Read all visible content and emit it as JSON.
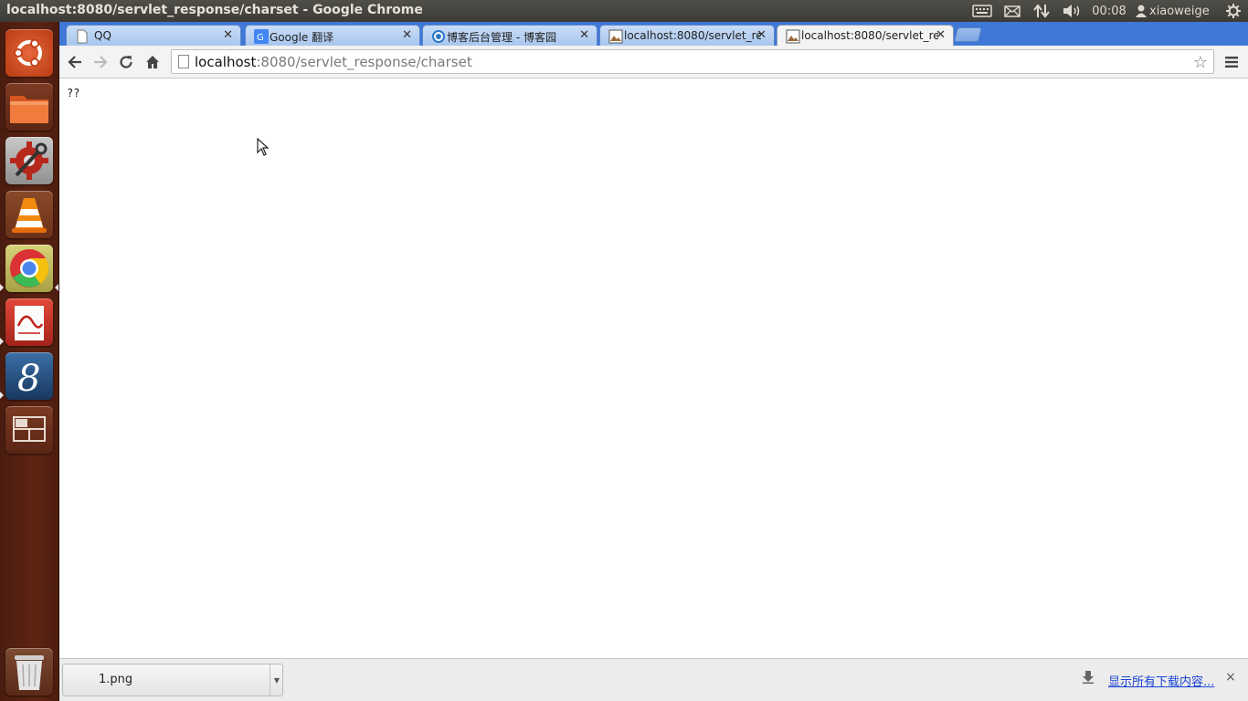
{
  "window": {
    "title": "localhost:8080/servlet_response/charset - Google Chrome"
  },
  "panel": {
    "clock": "00:08",
    "user": "xiaoweige",
    "icons": [
      "keyboard-icon",
      "mail-icon",
      "network-icon",
      "volume-icon",
      "user-icon",
      "session-gear-icon"
    ]
  },
  "launcher": {
    "items": [
      "dash-home",
      "files",
      "system-settings",
      "vlc",
      "chrome",
      "document-viewer",
      "scribes-editor",
      "workspace-switcher",
      "trash"
    ]
  },
  "tabs": [
    {
      "title": "QQ",
      "icon": "page-icon",
      "active": false
    },
    {
      "title": "Google 翻译",
      "icon": "google-icon",
      "active": false
    },
    {
      "title": "博客后台管理 - 博客园",
      "icon": "cnblogs-icon",
      "active": false
    },
    {
      "title": "localhost:8080/servlet_re",
      "icon": "image-icon",
      "active": false
    },
    {
      "title": "localhost:8080/servlet_re",
      "icon": "image-icon",
      "active": true
    }
  ],
  "toolbar": {
    "url_host": "localhost",
    "url_rest": ":8080/servlet_response/charset"
  },
  "content": {
    "text": "??"
  },
  "downloads": {
    "item_name": "1.png",
    "show_all": "显示所有下载内容...",
    "close": "×"
  },
  "colors": {
    "tabstrip": "#3f78d6",
    "launcher": "#5e2412",
    "panel": "#3c3b37",
    "link": "#1a44d6"
  }
}
